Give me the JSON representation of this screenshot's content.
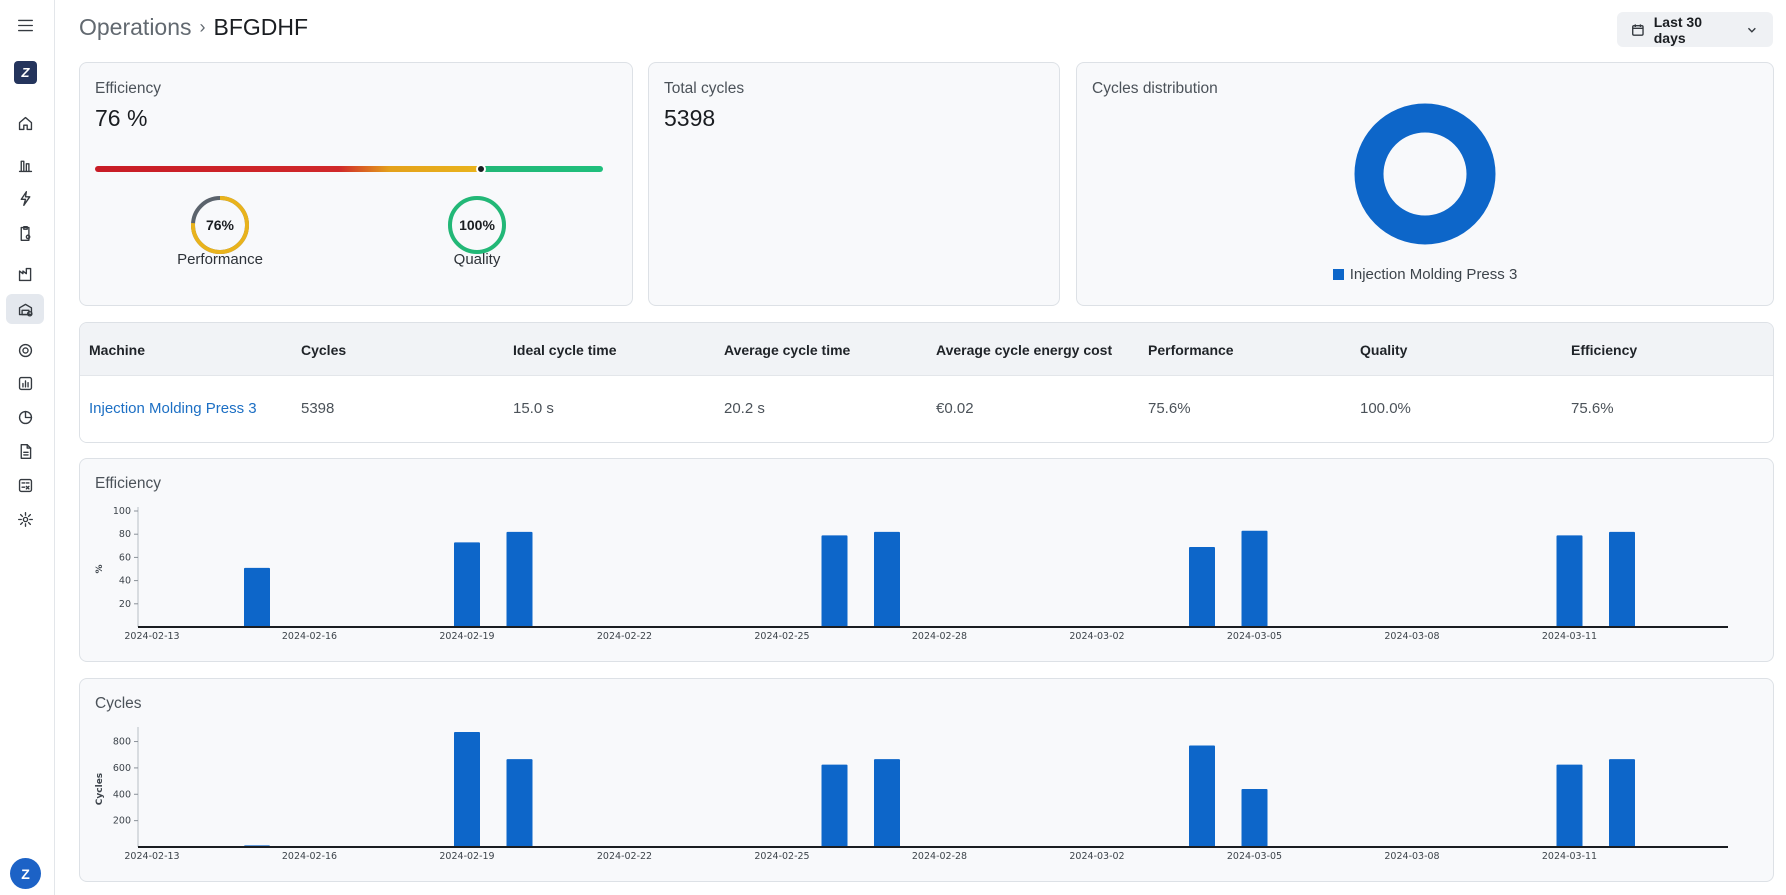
{
  "sidebar": {
    "menu_icon": "hamburger-menu-icon",
    "logo_text": "Z",
    "items": [
      {
        "icon": "home-icon"
      },
      {
        "icon": "bar-chart-icon"
      },
      {
        "icon": "energy-icon"
      },
      {
        "icon": "clipboard-settings-icon"
      },
      {
        "icon": "factory-icon"
      },
      {
        "icon": "operations-icon",
        "active": true
      },
      {
        "icon": "gear-icon"
      },
      {
        "icon": "report-chart-icon"
      },
      {
        "icon": "pie-chart-icon"
      },
      {
        "icon": "document-icon"
      },
      {
        "icon": "calculator-icon"
      },
      {
        "icon": "settings-icon"
      }
    ],
    "avatar_initial": "Z"
  },
  "header": {
    "breadcrumb_root": "Operations",
    "breadcrumb_current": "BFGDHF",
    "date_range": "Last 30 days"
  },
  "efficiency_card": {
    "title": "Efficiency",
    "value": "76 %",
    "marker_fraction": 0.76,
    "performance": {
      "value": "76%",
      "label": "Performance",
      "fraction": 0.76,
      "color": "#e9b31c"
    },
    "quality": {
      "value": "100%",
      "label": "Quality",
      "fraction": 1.0,
      "color": "#22b877"
    }
  },
  "total_cycles_card": {
    "title": "Total cycles",
    "value": "5398"
  },
  "distribution_card": {
    "title": "Cycles distribution",
    "legend": "Injection Molding Press 3",
    "color": "#0d66c9"
  },
  "table": {
    "headers": [
      "Machine",
      "Cycles",
      "Ideal cycle time",
      "Average cycle time",
      "Average cycle energy cost",
      "Performance",
      "Quality",
      "Efficiency"
    ],
    "rows": [
      [
        "Injection Molding Press 3",
        "5398",
        "15.0 s",
        "20.2 s",
        "€0.02",
        "75.6%",
        "100.0%",
        "75.6%"
      ]
    ]
  },
  "chart_data": [
    {
      "type": "bar",
      "title": "Efficiency",
      "ylabel": "%",
      "ylim": [
        0,
        100
      ],
      "yticks": [
        20,
        40,
        60,
        80,
        100
      ],
      "xticks": [
        "2024-02-13",
        "2024-02-16",
        "2024-02-19",
        "2024-02-22",
        "2024-02-25",
        "2024-02-28",
        "2024-03-02",
        "2024-03-05",
        "2024-03-08",
        "2024-03-11"
      ],
      "x": [
        "2024-02-15",
        "2024-02-19",
        "2024-02-20",
        "2024-02-26",
        "2024-02-27",
        "2024-03-04",
        "2024-03-05",
        "2024-03-11",
        "2024-03-12"
      ],
      "values": [
        51,
        73,
        82,
        79,
        82,
        69,
        83,
        79,
        82
      ],
      "color": "#0d66c9"
    },
    {
      "type": "bar",
      "title": "Cycles",
      "ylabel": "Cycles",
      "ylim": [
        0,
        880
      ],
      "yticks": [
        200,
        400,
        600,
        800
      ],
      "xticks": [
        "2024-02-13",
        "2024-02-16",
        "2024-02-19",
        "2024-02-22",
        "2024-02-25",
        "2024-02-28",
        "2024-03-02",
        "2024-03-05",
        "2024-03-08",
        "2024-03-11"
      ],
      "x": [
        "2024-02-15",
        "2024-02-19",
        "2024-02-20",
        "2024-02-26",
        "2024-02-27",
        "2024-03-04",
        "2024-03-05",
        "2024-03-11",
        "2024-03-12"
      ],
      "values": [
        12,
        872,
        667,
        625,
        667,
        770,
        440,
        625,
        667
      ],
      "color": "#0d66c9"
    }
  ]
}
